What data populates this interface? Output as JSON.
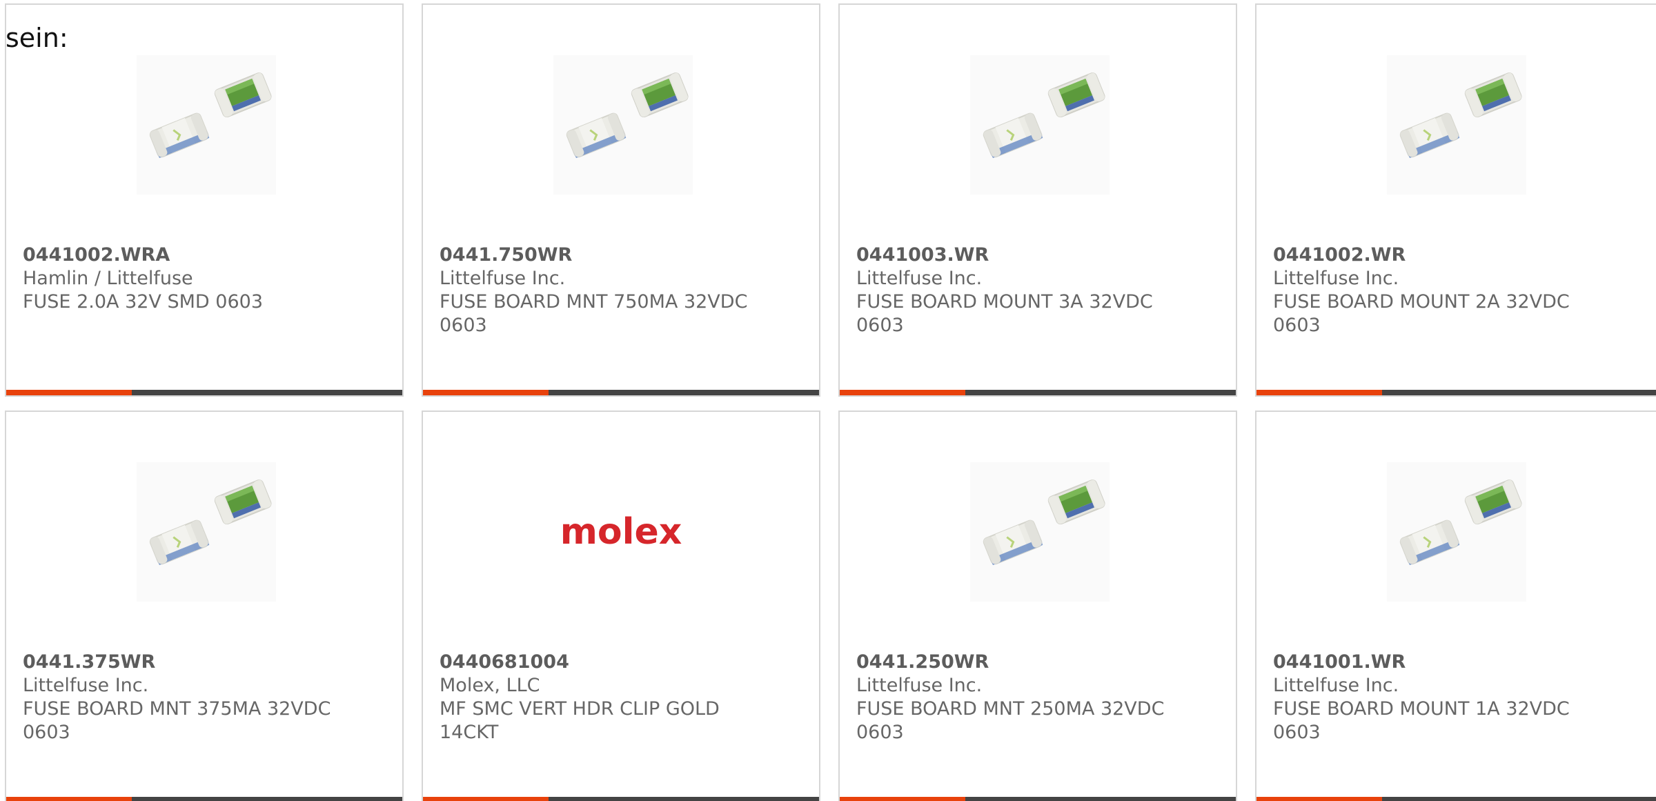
{
  "intro_text": "sein:",
  "colors": {
    "accent": "#e8420c",
    "bar": "#444444",
    "border": "#d6d6d6",
    "text": "#666666",
    "molex_red": "#d6262b"
  },
  "products": [
    {
      "part": "0441002.WRA",
      "manufacturer": "Hamlin / Littelfuse",
      "description": "FUSE 2.0A 32V SMD 0603",
      "image": "smd-fuse-image"
    },
    {
      "part": "0441.750WR",
      "manufacturer": "Littelfuse Inc.",
      "description": "FUSE BOARD MNT 750MA 32VDC 0603",
      "image": "smd-fuse-image"
    },
    {
      "part": "0441003.WR",
      "manufacturer": "Littelfuse Inc.",
      "description": "FUSE BOARD MOUNT 3A 32VDC 0603",
      "image": "smd-fuse-image"
    },
    {
      "part": "0441002.WR",
      "manufacturer": "Littelfuse Inc.",
      "description": "FUSE BOARD MOUNT 2A 32VDC 0603",
      "image": "smd-fuse-image"
    },
    {
      "part": "0441.375WR",
      "manufacturer": "Littelfuse Inc.",
      "description": "FUSE BOARD MNT 375MA 32VDC 0603",
      "image": "smd-fuse-image"
    },
    {
      "part": "0440681004",
      "manufacturer": "Molex, LLC",
      "description": "MF SMC VERT HDR CLIP GOLD 14CKT",
      "image": "molex-logo",
      "logo_text": "molex"
    },
    {
      "part": "0441.250WR",
      "manufacturer": "Littelfuse Inc.",
      "description": "FUSE BOARD MNT 250MA 32VDC 0603",
      "image": "smd-fuse-image"
    },
    {
      "part": "0441001.WR",
      "manufacturer": "Littelfuse Inc.",
      "description": "FUSE BOARD MOUNT 1A 32VDC 0603",
      "image": "smd-fuse-image"
    }
  ]
}
